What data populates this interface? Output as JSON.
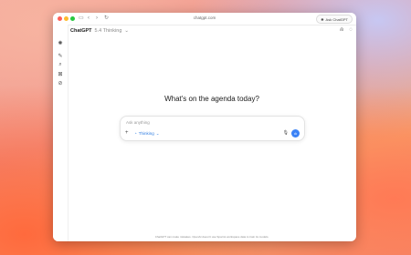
{
  "browser": {
    "url": "chatgpt.com",
    "ask_label": "Ask ChatGPT"
  },
  "header": {
    "model": "ChatGPT",
    "mode": "5.4 Thinking"
  },
  "main": {
    "headline": "What's on the agenda today?"
  },
  "composer": {
    "placeholder": "Ask anything",
    "mode_chip": "Thinking"
  },
  "footer": {
    "disclaimer": "ChatGPT can make mistakes. OpenAI doesn't use Sparrot workspace data to train its models."
  },
  "colors": {
    "accent": "#3b82f6",
    "chip": "#2f7de1"
  }
}
